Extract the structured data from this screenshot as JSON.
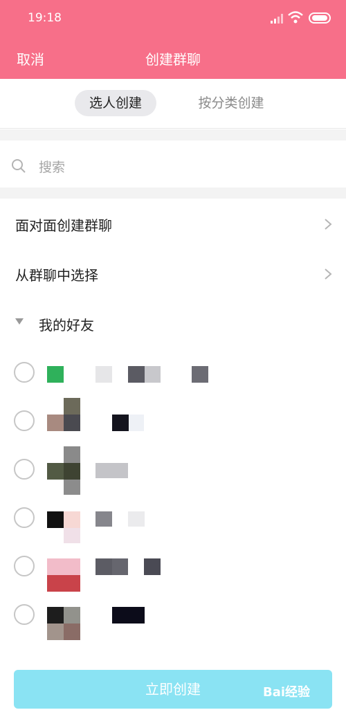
{
  "status_bar": {
    "time": "19:18"
  },
  "header": {
    "cancel_label": "取消",
    "title": "创建群聊"
  },
  "tabs": [
    {
      "label": "选人创建",
      "active": true
    },
    {
      "label": "按分类创建",
      "active": false
    }
  ],
  "search": {
    "placeholder": "搜索"
  },
  "menu": [
    {
      "label": "面对面创建群聊"
    },
    {
      "label": "从群聊中选择"
    }
  ],
  "group": {
    "label": "我的好友",
    "expanded": true
  },
  "contacts": [
    {
      "selected": false
    },
    {
      "selected": false
    },
    {
      "selected": false
    },
    {
      "selected": false
    },
    {
      "selected": false
    },
    {
      "selected": false
    }
  ],
  "create_button": {
    "label": "立即创建"
  },
  "watermark": {
    "text": "Bai经验"
  },
  "colors": {
    "accent": "#f76f89",
    "button": "#8ae3f3"
  }
}
